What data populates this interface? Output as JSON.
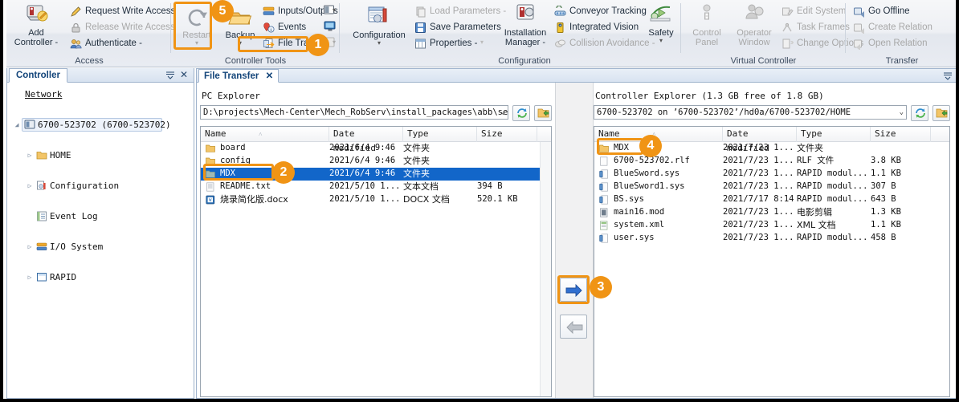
{
  "ribbon": {
    "groups": [
      {
        "label": "Access"
      },
      {
        "label": "Controller Tools"
      },
      {
        "label": "Configuration"
      },
      {
        "label": "Virtual Controller"
      },
      {
        "label": "Transfer"
      }
    ],
    "add_controller": "Add\nController -",
    "add_controller_l1": "Add",
    "add_controller_l2": "Controller -",
    "request_write_access": "Request Write Access",
    "release_write_access": "Release Write Access",
    "authenticate": "Authenticate -",
    "restart": "Restart",
    "backup": "Backup",
    "inputs_outputs": "Inputs/Outputs",
    "events": "Events",
    "file_transfer": "File Transfer",
    "configuration_l1": "Configuration",
    "load_parameters": "Load Parameters -",
    "save_parameters": "Save Parameters",
    "properties": "Properties -",
    "installation_manager_l1": "Installation",
    "installation_manager_l2": "Manager -",
    "conveyor_tracking": "Conveyor Tracking",
    "integrated_vision": "Integrated Vision",
    "collision_avoidance": "Collision Avoidance -",
    "safety": "Safety",
    "control_panel_l1": "Control",
    "control_panel_l2": "Panel",
    "operator_window_l1": "Operator",
    "operator_window_l2": "Window",
    "edit_system": "Edit System",
    "task_frames": "Task Frames",
    "change_options": "Change Options",
    "go_offline": "Go Offline",
    "create_relation": "Create Relation",
    "open_relation": "Open Relation"
  },
  "callouts": [
    {
      "n": "1"
    },
    {
      "n": "2"
    },
    {
      "n": "3"
    },
    {
      "n": "4"
    },
    {
      "n": "5"
    }
  ],
  "sidebar": {
    "tab_label": "Controller",
    "pin_icon": "☰",
    "close_icon": "✕",
    "items": [
      {
        "label": "Network",
        "indent": 0,
        "expander": "",
        "icon": "none"
      },
      {
        "label": "6700-523702  (6700-523702)",
        "indent": 1,
        "expander": "◢",
        "icon": "controller"
      },
      {
        "label": "HOME",
        "indent": 2,
        "expander": "▷",
        "icon": "folder"
      },
      {
        "label": "Configuration",
        "indent": 2,
        "expander": "▷",
        "icon": "config"
      },
      {
        "label": "Event Log",
        "indent": 2,
        "expander": "",
        "icon": "eventlog"
      },
      {
        "label": "I/O System",
        "indent": 2,
        "expander": "▷",
        "icon": "io"
      },
      {
        "label": "RAPID",
        "indent": 2,
        "expander": "▷",
        "icon": "rapid"
      }
    ]
  },
  "document": {
    "tab_label": "File Transfer",
    "tab_close": "✕",
    "overflow_icon": "☰"
  },
  "pc_explorer": {
    "title": "PC Explorer",
    "path_value": "D:\\projects\\Mech-Center\\Mech_RobServ\\install_packages\\abb\\server  ·",
    "path_caret": "⌄",
    "refresh_icon": "refresh-icon",
    "open_folder_icon": "open-folder-icon",
    "columns": [
      "Name",
      "Date modified",
      "Type",
      "Size"
    ],
    "sort_indicator": "˄",
    "rows": [
      {
        "name": "board",
        "date": "2021/6/4  9:46",
        "type": "文件夹",
        "size": "",
        "icon": "folder",
        "selected": false
      },
      {
        "name": "config",
        "date": "2021/6/4  9:46",
        "type": "文件夹",
        "size": "",
        "icon": "folder",
        "selected": false
      },
      {
        "name": "MDX",
        "date": "2021/6/4  9:46",
        "type": "文件夹",
        "size": "",
        "icon": "folder",
        "selected": true
      },
      {
        "name": "README.txt",
        "date": "2021/5/10 1...",
        "type": "文本文档",
        "size": "394 B",
        "icon": "text",
        "selected": false
      },
      {
        "name": "烧录简化版.docx",
        "date": "2021/5/10 1...",
        "type": "DOCX 文档",
        "size": "520.1 KB",
        "icon": "docx",
        "selected": false
      }
    ]
  },
  "transfer": {
    "to_controller_icon": "arrow-right-icon",
    "to_pc_icon": "arrow-left-icon"
  },
  "controller_explorer": {
    "title": "Controller Explorer (1.3 GB free of 1.8 GB)",
    "path_value": "6700-523702 on ’6700-523702’/hd0a/6700-523702/HOME",
    "path_caret": "⌄",
    "refresh_icon": "refresh-icon",
    "open_folder_icon": "open-folder-icon",
    "columns": [
      "Name",
      "Date modified",
      "Type",
      "Size"
    ],
    "sort_indicator": "˄",
    "rows": [
      {
        "name": "MDX",
        "date": "2021/7/23 1...",
        "type": "文件夹",
        "size": "",
        "icon": "folder"
      },
      {
        "name": "6700-523702.rlf",
        "date": "2021/7/23 1...",
        "type": "RLF 文件",
        "size": "3.8 KB",
        "icon": "blank"
      },
      {
        "name": "BlueSword.sys",
        "date": "2021/7/23 1...",
        "type": "RAPID modul...",
        "size": "1.1 KB",
        "icon": "rapid"
      },
      {
        "name": "BlueSword1.sys",
        "date": "2021/7/23 1...",
        "type": "RAPID modul...",
        "size": "307 B",
        "icon": "rapid"
      },
      {
        "name": "BS.sys",
        "date": "2021/7/17 8:14",
        "type": "RAPID modul...",
        "size": "643 B",
        "icon": "rapid"
      },
      {
        "name": "main16.mod",
        "date": "2021/7/23 1...",
        "type": "电影剪辑",
        "size": "1.3 KB",
        "icon": "mod"
      },
      {
        "name": "system.xml",
        "date": "2021/7/23 1...",
        "type": "XML 文档",
        "size": "1.1 KB",
        "icon": "xml"
      },
      {
        "name": "user.sys",
        "date": "2021/7/23 1...",
        "type": "RAPID modul...",
        "size": "458 B",
        "icon": "rapid"
      }
    ]
  },
  "colors": {
    "callout": "#f09415",
    "selection": "#1266c9",
    "ribbon_text": "#22303f",
    "disabled_text": "#a8a8a8"
  }
}
